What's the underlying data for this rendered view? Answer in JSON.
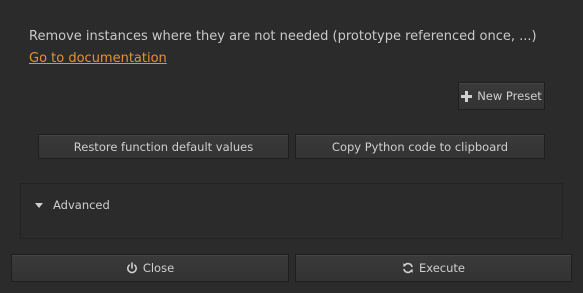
{
  "description": "Remove instances where they are not needed (prototype referenced once, ...)",
  "doc_link": "Go to documentation",
  "buttons": {
    "new_preset": "New Preset",
    "restore_defaults": "Restore function default values",
    "copy_python": "Copy Python code to clipboard",
    "close": "Close",
    "execute": "Execute"
  },
  "advanced": {
    "label": "Advanced",
    "expanded": false
  },
  "icons": {
    "new_preset": "plus-icon",
    "close": "power-icon",
    "execute": "refresh-icon",
    "advanced": "triangle-down-icon"
  },
  "colors": {
    "background": "#2b2b2b",
    "link": "#e0962c",
    "text": "#c9c9c9"
  }
}
